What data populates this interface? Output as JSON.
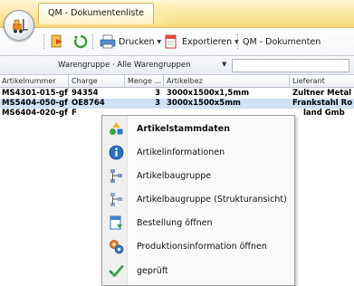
{
  "window": {
    "tab_title": "QM - Dokumentenliste"
  },
  "toolbar": {
    "print_label": "Drucken",
    "export_label": "Exportieren",
    "qm_documents_label": "QM - Dokumenten"
  },
  "filter": {
    "label": "Warengruppe · Alle Warengruppen",
    "search_value": ""
  },
  "grid": {
    "columns": [
      "Artikelnummer",
      "Charge",
      "Menge ...",
      "Artikelbez",
      "Lieferant"
    ],
    "rows": [
      {
        "artikelnummer": "MS4301-015-gf",
        "charge": "94354",
        "menge": "3",
        "artikelbez": "3000x1500x1,5mm",
        "lieferant": "Zultner Metal",
        "selected": false
      },
      {
        "artikelnummer": "MS5404-050-gf",
        "charge": "OE8764",
        "menge": "3",
        "artikelbez": "3000x1500x5mm",
        "lieferant": "Frankstahl Ro",
        "selected": true
      },
      {
        "artikelnummer": "MS6404-020-gf",
        "charge": "F",
        "menge": "",
        "artikelbez": "",
        "lieferant": "land Gmb",
        "selected": false
      }
    ]
  },
  "context_menu": {
    "items": [
      {
        "label": "Artikelstammdaten",
        "icon": "shapes-icon",
        "bold": true
      },
      {
        "label": "Artikelinformationen",
        "icon": "info-icon",
        "bold": false
      },
      {
        "label": "Artikelbaugruppe",
        "icon": "assembly-icon",
        "bold": false
      },
      {
        "label": "Artikelbaugruppe (Strukturansicht)",
        "icon": "assembly-tree-icon",
        "bold": false
      },
      {
        "label": "Bestellung öffnen",
        "icon": "order-icon",
        "bold": false
      },
      {
        "label": "Produktionsinformation öffnen",
        "icon": "production-icon",
        "bold": false
      },
      {
        "label": "geprüft",
        "icon": "checkmark-icon",
        "bold": false
      }
    ]
  },
  "colors": {
    "selected_row": "#cfe1f3",
    "title_gradient_end": "#f7d977",
    "menu_background": "#fafafa"
  }
}
